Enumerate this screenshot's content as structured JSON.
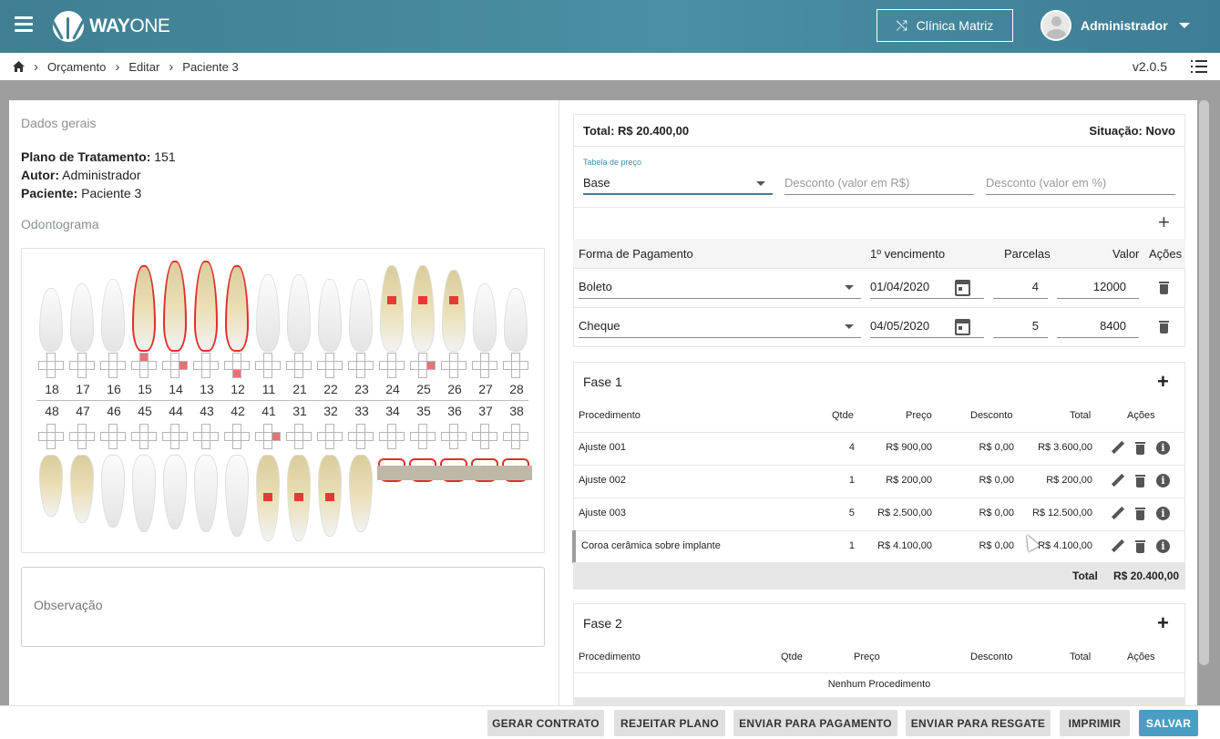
{
  "header": {
    "logo_text_bold": "WAY",
    "logo_text_light": "ONE",
    "clinic_button": "Clínica Matriz",
    "user_name": "Administrador"
  },
  "breadcrumb": {
    "items": [
      "Orçamento",
      "Editar",
      "Paciente 3"
    ],
    "version": "v2.0.5"
  },
  "left": {
    "dados_gerais_title": "Dados gerais",
    "plano_label": "Plano de Tratamento:",
    "plano_value": "151",
    "autor_label": "Autor:",
    "autor_value": "Administrador",
    "paciente_label": "Paciente:",
    "paciente_value": "Paciente 3",
    "odontograma_title": "Odontograma",
    "upper_teeth": [
      "18",
      "17",
      "16",
      "15",
      "14",
      "13",
      "12",
      "11",
      "21",
      "22",
      "23",
      "24",
      "25",
      "26",
      "27",
      "28"
    ],
    "lower_teeth": [
      "48",
      "47",
      "46",
      "45",
      "44",
      "43",
      "42",
      "41",
      "31",
      "32",
      "33",
      "34",
      "35",
      "36",
      "37",
      "38"
    ],
    "observacao_placeholder": "Observação"
  },
  "summary": {
    "total": "Total: R$ 20.400,00",
    "situacao": "Situação: Novo",
    "tabela_label": "Tabela de preço",
    "tabela_value": "Base",
    "desconto_rs_placeholder": "Desconto (valor em R$)",
    "desconto_pct_placeholder": "Desconto (valor em %)",
    "pay_headers": [
      "Forma de Pagamento",
      "1º vencimento",
      "Parcelas",
      "Valor",
      "Ações"
    ],
    "payments": [
      {
        "forma": "Boleto",
        "vencimento": "01/04/2020",
        "parcelas": "4",
        "valor": "12000"
      },
      {
        "forma": "Cheque",
        "vencimento": "04/05/2020",
        "parcelas": "5",
        "valor": "8400"
      }
    ]
  },
  "fase1": {
    "title": "Fase 1",
    "headers": [
      "Procedimento",
      "Qtde",
      "Preço",
      "Desconto",
      "Total",
      "Ações"
    ],
    "rows": [
      {
        "proc": "Ajuste 001",
        "qtde": "4",
        "preco": "R$ 900,00",
        "desconto": "R$ 0,00",
        "total": "R$ 3.600,00"
      },
      {
        "proc": "Ajuste 002",
        "qtde": "1",
        "preco": "R$ 200,00",
        "desconto": "R$ 0,00",
        "total": "R$ 200,00"
      },
      {
        "proc": "Ajuste 003",
        "qtde": "5",
        "preco": "R$ 2.500,00",
        "desconto": "R$ 0,00",
        "total": "R$ 12.500,00"
      },
      {
        "proc": "Coroa cerâmica sobre implante",
        "qtde": "1",
        "preco": "R$ 4.100,00",
        "desconto": "R$ 0,00",
        "total": "R$ 4.100,00"
      }
    ],
    "total_label": "Total",
    "total_value": "R$ 20.400,00"
  },
  "fase2": {
    "title": "Fase 2",
    "headers": [
      "Procedimento",
      "Qtde",
      "Preço",
      "Desconto",
      "Total",
      "Ações"
    ],
    "empty": "Nenhum Procedimento"
  },
  "footer": {
    "buttons": [
      "GERAR CONTRATO",
      "REJEITAR PLANO",
      "ENVIAR PARA PAGAMENTO",
      "ENVIAR PARA RESGATE",
      "IMPRIMIR",
      "SALVAR"
    ]
  },
  "colors": {
    "header_bg": "#4a8fa4",
    "primary_button": "#4a9ec4",
    "mark_red": "#e53935"
  }
}
